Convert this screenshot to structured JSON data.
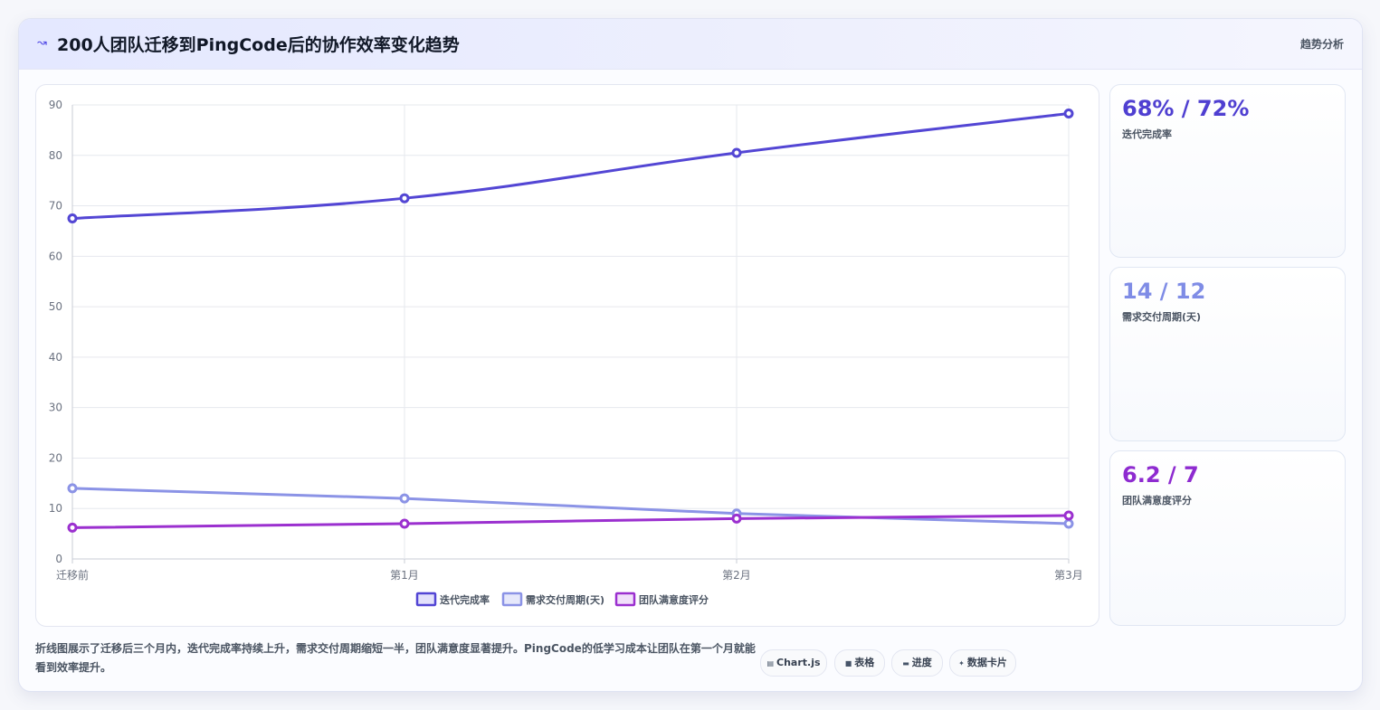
{
  "header": {
    "title": "200人团队迁移到PingCode后的协作效率变化趋势",
    "title_icon": "trend-icon",
    "tag": "趋势分析"
  },
  "chart_data": {
    "type": "line",
    "categories": [
      "迁移前",
      "第1月",
      "第2月",
      "第3月"
    ],
    "ylim": [
      0,
      90
    ],
    "yticks": [
      0,
      10,
      20,
      30,
      40,
      50,
      60,
      70,
      80,
      90
    ],
    "grid": true,
    "legend_position": "bottom",
    "series": [
      {
        "name": "迭代完成率",
        "values": [
          67.5,
          71.5,
          80.5,
          88.3
        ],
        "color": "#5346d4"
      },
      {
        "name": "需求交付周期(天)",
        "values": [
          14,
          12,
          9,
          7
        ],
        "color": "#8b93e6"
      },
      {
        "name": "团队满意度评分",
        "values": [
          6.2,
          7,
          8,
          8.6
        ],
        "color": "#9b30cf"
      }
    ]
  },
  "stats": [
    {
      "value": "68% / 72%",
      "label": "迭代完成率",
      "color": "#4f3fd1"
    },
    {
      "value": "14 / 12",
      "label": "需求交付周期(天)",
      "color": "#7f8ce6"
    },
    {
      "value": "6.2 / 7",
      "label": "团队满意度评分",
      "color": "#8e2bd0"
    }
  ],
  "footer": {
    "description": "折线图展示了迁移后三个月内，迭代完成率持续上升，需求交付周期缩短一半，团队满意度显著提升。PingCode的低学习成本让团队在第一个月就能看到效率提升。",
    "chips": [
      {
        "label": "Chart.js",
        "icon": "chart-icon"
      },
      {
        "label": "表格",
        "icon": "table-icon"
      },
      {
        "label": "进度",
        "icon": "progress-icon"
      },
      {
        "label": "数据卡片",
        "icon": "sparkle-icon"
      }
    ]
  }
}
